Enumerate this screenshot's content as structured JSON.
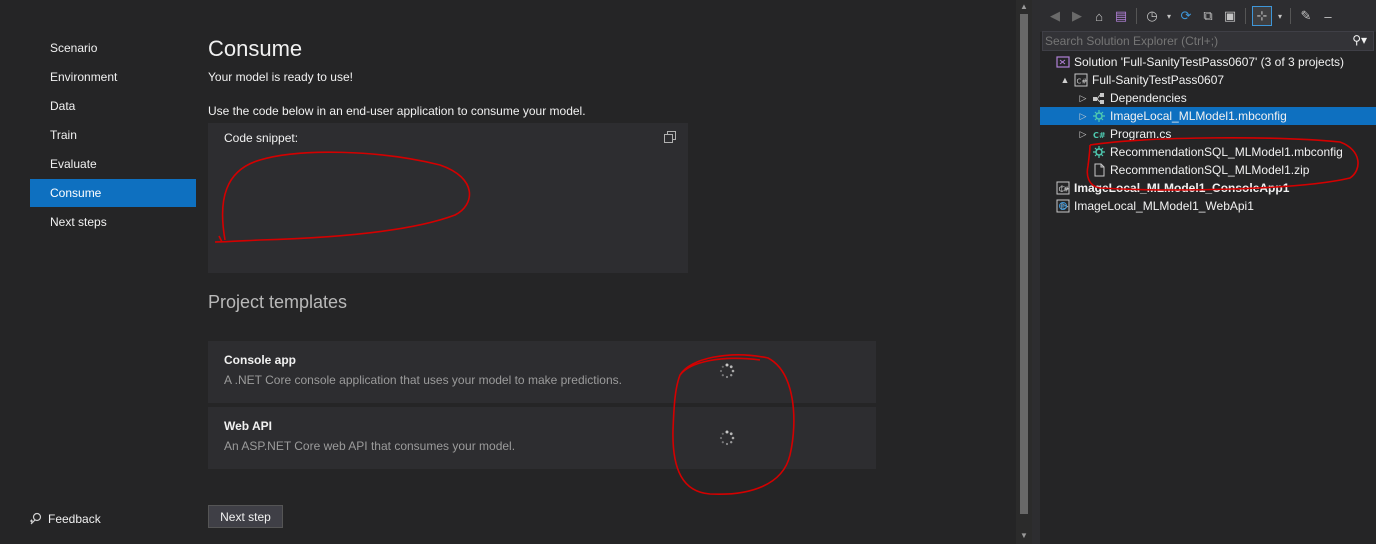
{
  "nav": {
    "items": [
      {
        "label": "Scenario",
        "active": false
      },
      {
        "label": "Environment",
        "active": false
      },
      {
        "label": "Data",
        "active": false
      },
      {
        "label": "Train",
        "active": false
      },
      {
        "label": "Evaluate",
        "active": false
      },
      {
        "label": "Consume",
        "active": true
      },
      {
        "label": "Next steps",
        "active": false
      }
    ],
    "feedback_label": "Feedback"
  },
  "main": {
    "title": "Consume",
    "subtitle": "Your model is ready to use!",
    "instructions": "Use the code below in an end-user application to consume your model.",
    "code_snippet_label": "Code snippet:",
    "project_templates_title": "Project templates",
    "templates": [
      {
        "title": "Console app",
        "description": "A .NET Core console application that uses your model to make predictions."
      },
      {
        "title": "Web API",
        "description": "An ASP.NET Core web API that consumes your model."
      }
    ],
    "next_step_label": "Next step"
  },
  "solution_explorer": {
    "search_placeholder": "Search Solution Explorer (Ctrl+;)",
    "search_icon": "search-icon",
    "tree": [
      {
        "label": "Solution 'Full-SanityTestPass0607' (3 of 3 projects)",
        "icon": "solution-icon",
        "expander": "",
        "bold": false,
        "selected": false
      },
      {
        "label": "Full-SanityTestPass0607",
        "icon": "csharp-project-icon",
        "expander": "▲",
        "bold": false,
        "selected": false
      },
      {
        "label": "Dependencies",
        "icon": "dependencies-icon",
        "expander": "▷",
        "bold": false,
        "selected": false
      },
      {
        "label": "ImageLocal_MLModel1.mbconfig",
        "icon": "mbconfig-icon",
        "expander": "▷",
        "bold": false,
        "selected": true
      },
      {
        "label": "Program.cs",
        "icon": "csharp-file-icon",
        "expander": "▷",
        "bold": false,
        "selected": false
      },
      {
        "label": "RecommendationSQL_MLModel1.mbconfig",
        "icon": "mbconfig-icon",
        "expander": "",
        "bold": false,
        "selected": false
      },
      {
        "label": "RecommendationSQL_MLModel1.zip",
        "icon": "file-icon",
        "expander": "",
        "bold": false,
        "selected": false
      },
      {
        "label": "ImageLocal_MLModel1_ConsoleApp1",
        "icon": "csharp-project-icon",
        "expander": "▷",
        "bold": true,
        "selected": false
      },
      {
        "label": "ImageLocal_MLModel1_WebApi1",
        "icon": "web-project-icon",
        "expander": "▷",
        "bold": false,
        "selected": false
      }
    ]
  },
  "colors": {
    "accent": "#0e70c0",
    "annotation": "#d40000",
    "background": "#252526"
  }
}
